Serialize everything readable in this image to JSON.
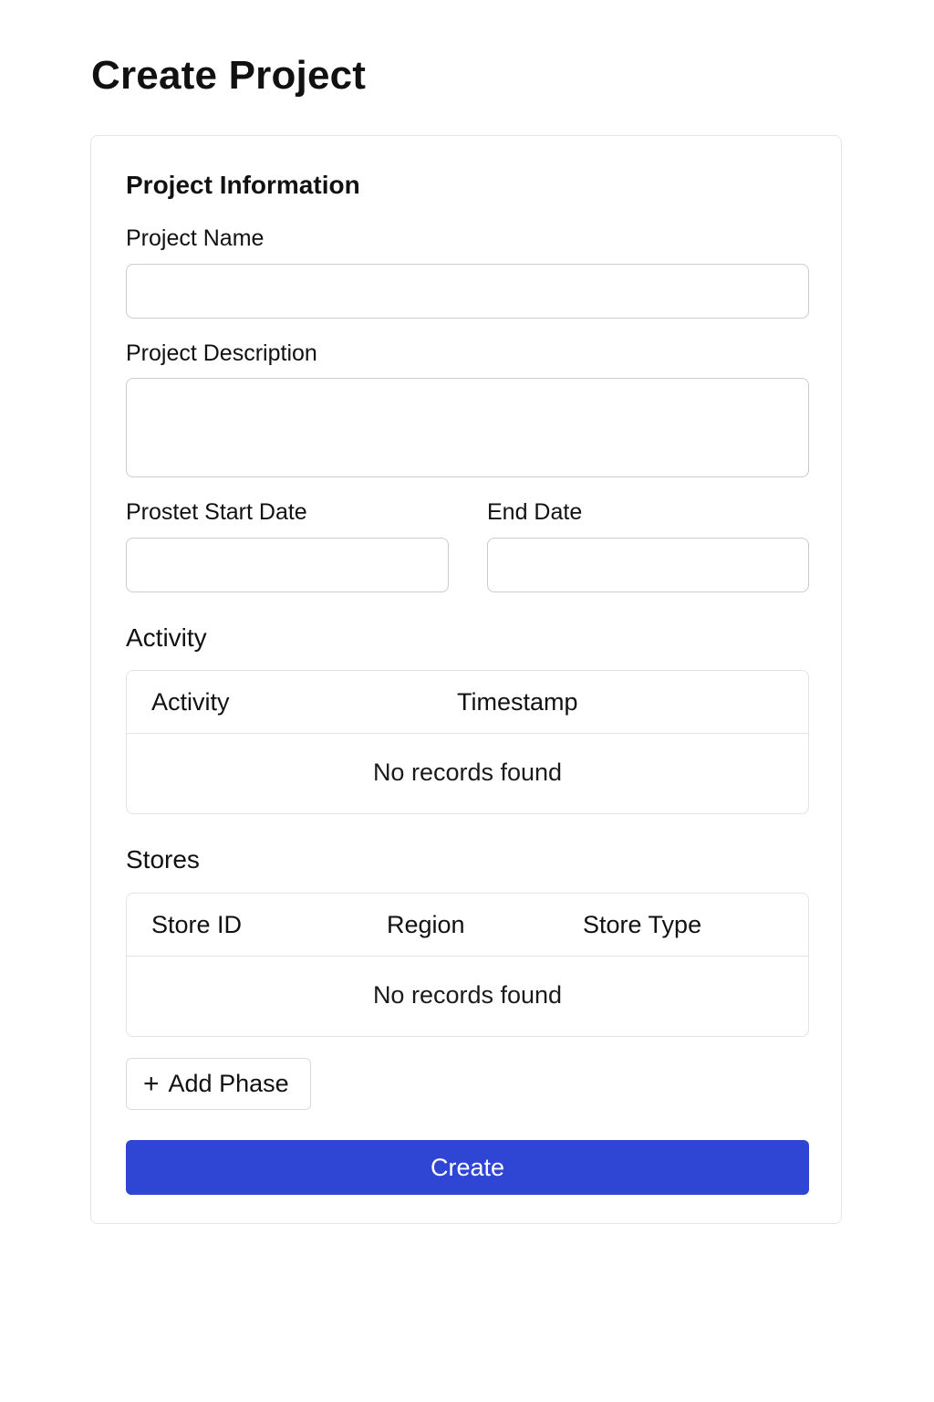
{
  "page": {
    "title": "Create Project"
  },
  "form": {
    "section_title": "Project Information",
    "project_name": {
      "label": "Project Name",
      "value": "",
      "placeholder": ""
    },
    "project_description": {
      "label": "Project Description",
      "value": "",
      "placeholder": ""
    },
    "start_date": {
      "label": "Prostet Start Date",
      "value": "",
      "placeholder": ""
    },
    "end_date": {
      "label": "End Date",
      "value": "",
      "placeholder": ""
    }
  },
  "activity": {
    "section_title": "Activity",
    "columns": [
      "Activity",
      "Timestamp"
    ],
    "empty_text": "No records found"
  },
  "stores": {
    "section_title": "Stores",
    "columns": [
      "Store ID",
      "Region",
      "Store Type"
    ],
    "empty_text": "No records found"
  },
  "actions": {
    "add_phase_icon": "+",
    "add_phase_label": "Add Phase",
    "create_label": "Create"
  },
  "colors": {
    "primary": "#2f45d4",
    "border": "#c9cbd0"
  }
}
